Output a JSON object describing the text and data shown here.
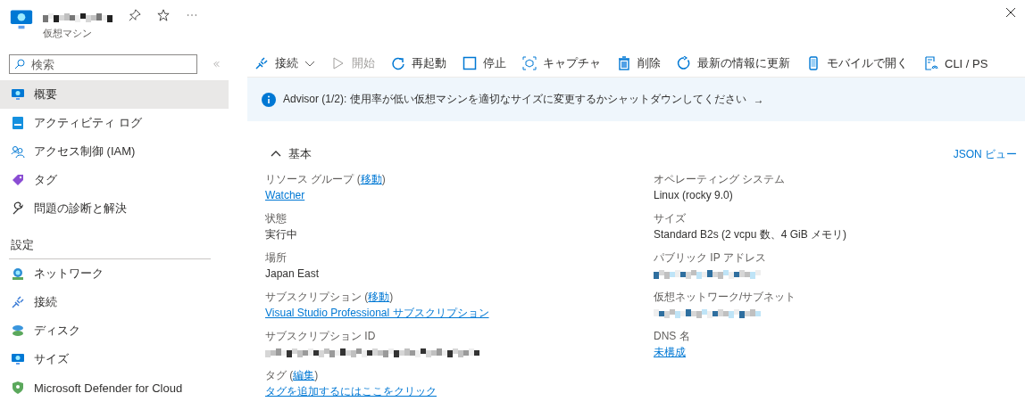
{
  "header": {
    "title": {
      "redacted": true
    },
    "subtitle": "仮想マシン",
    "pinned": false,
    "favorite": false
  },
  "sidebar": {
    "search": {
      "placeholder": "検索"
    },
    "items": [
      {
        "label": "概要",
        "selected": true
      },
      {
        "label": "アクティビティ ログ",
        "selected": false
      },
      {
        "label": "アクセス制御 (IAM)",
        "selected": false
      },
      {
        "label": "タグ",
        "selected": false
      },
      {
        "label": "問題の診断と解決",
        "selected": false
      }
    ],
    "sections": [
      {
        "title": "設定",
        "items": [
          {
            "label": "ネットワーク",
            "selected": false
          },
          {
            "label": "接続",
            "selected": false
          },
          {
            "label": "ディスク",
            "selected": false
          },
          {
            "label": "サイズ",
            "selected": false
          },
          {
            "label": "Microsoft Defender for Cloud",
            "selected": false
          }
        ]
      }
    ]
  },
  "toolbar": [
    {
      "label": "接続",
      "disabled": false,
      "dropdown": true
    },
    {
      "label": "開始",
      "disabled": true,
      "dropdown": false
    },
    {
      "label": "再起動",
      "disabled": false,
      "dropdown": false
    },
    {
      "label": "停止",
      "disabled": false,
      "dropdown": false
    },
    {
      "label": "キャプチャ",
      "disabled": false,
      "dropdown": false
    },
    {
      "label": "削除",
      "disabled": false,
      "dropdown": false
    },
    {
      "label": "最新の情報に更新",
      "disabled": false,
      "dropdown": false
    },
    {
      "label": "モバイルで開く",
      "disabled": false,
      "dropdown": false
    },
    {
      "label": "CLI / PS",
      "disabled": false,
      "dropdown": false
    }
  ],
  "advisor": {
    "text": "Advisor (1/2): 使用率が低い仮想マシンを適切なサイズに変更するかシャットダウンしてください",
    "arrow": "→"
  },
  "essentials": {
    "title": "基本",
    "expanded": true,
    "json_view": "JSON ビュー",
    "left": [
      {
        "label": "リソース グループ (",
        "label_link": "移動",
        "label_end": ")",
        "value": "Watcher",
        "link": true,
        "redacted": false
      },
      {
        "label": "状態",
        "value": "実行中",
        "link": false,
        "redacted": false
      },
      {
        "label": "場所",
        "value": "Japan East",
        "link": false,
        "redacted": false
      },
      {
        "label": "サブスクリプション (",
        "label_link": "移動",
        "label_end": ")",
        "value": "Visual Studio Professional サブスクリプション",
        "link": true,
        "redacted": false
      },
      {
        "label": "サブスクリプション ID",
        "link": false,
        "redacted": true
      },
      {
        "label": "タグ (",
        "label_link": "編集",
        "label_end": ")",
        "value": "タグを追加するにはここをクリック",
        "link": true,
        "redacted": false
      }
    ],
    "right": [
      {
        "label": "オペレーティング システム",
        "value": "Linux (rocky 9.0)",
        "link": false,
        "redacted": false
      },
      {
        "label": "サイズ",
        "value": "Standard B2s (2 vcpu 数、4 GiB メモリ)",
        "link": false,
        "redacted": false
      },
      {
        "label": "パブリック IP アドレス",
        "link": true,
        "redacted": true
      },
      {
        "label": "仮想ネットワーク/サブネット",
        "link": true,
        "redacted": true
      },
      {
        "label": "DNS 名",
        "value": "未構成",
        "link": true,
        "redacted": false
      }
    ]
  }
}
